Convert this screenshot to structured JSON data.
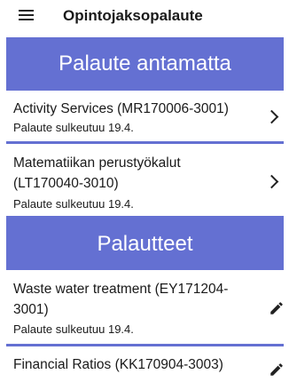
{
  "app_bar": {
    "menu_icon": "menu-icon",
    "title": "Opintojaksopalaute"
  },
  "sections": {
    "pending": {
      "header": "Palaute antamatta",
      "items": [
        {
          "title": "Activity Services (MR170006-3001)",
          "subtitle": "Palaute sulkeutuu 19.4.",
          "action_icon": "chevron-right-icon"
        },
        {
          "title": "Matematiikan perustyökalut (LT170040-3010)",
          "subtitle": "Palaute sulkeutuu 19.4.",
          "action_icon": "chevron-right-icon"
        }
      ]
    },
    "given": {
      "header": "Palautteet",
      "items": [
        {
          "title": "Waste water treatment (EY171204-3001)",
          "subtitle": "Palaute sulkeutuu 19.4.",
          "action_icon": "pencil-icon"
        },
        {
          "title": "Financial Ratios (KK170904-3003)",
          "action_icon": "pencil-icon"
        }
      ]
    }
  },
  "colors": {
    "accent": "#6470d2",
    "text": "#1a1a1a",
    "background": "#ffffff"
  }
}
